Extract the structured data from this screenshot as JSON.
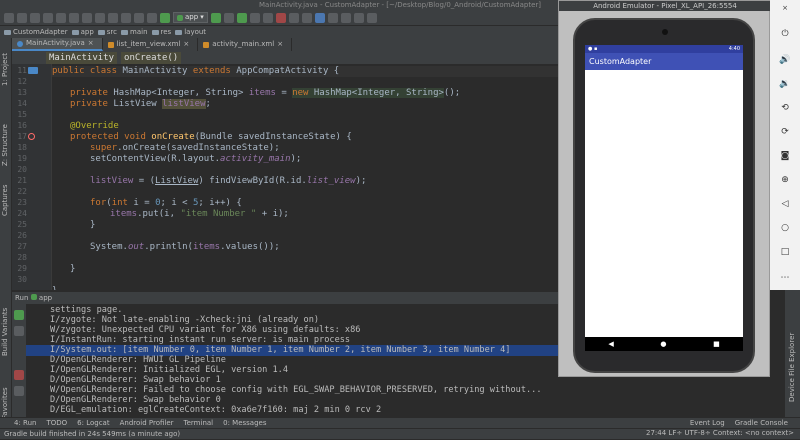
{
  "window_title": "MainActivity.java - CustomAdapter - [~/Desktop/Blog/0_Android/CustomAdapter]",
  "toolbar": {
    "run_config": "app"
  },
  "nav": {
    "items": [
      "CustomAdapter",
      "app",
      "src",
      "main",
      "res",
      "layout"
    ]
  },
  "left_strip": {
    "project": "1: Project",
    "structure": "Z: Structure",
    "captures": "Captures",
    "build_variants": "Build Variants",
    "favorites": "2: Favorites"
  },
  "tabs": [
    {
      "label": "MainActivity.java"
    },
    {
      "label": "list_item_view.xml"
    },
    {
      "label": "activity_main.xml"
    }
  ],
  "breadcrumb": {
    "class": "MainActivity",
    "method": "onCreate()"
  },
  "line_numbers": [
    "11",
    "12",
    "13",
    "14",
    "15",
    "16",
    "17",
    "18",
    "19",
    "20",
    "21",
    "22",
    "23",
    "24",
    "25",
    "26",
    "27",
    "28",
    "29",
    "30",
    "31",
    "32"
  ],
  "code": {
    "l11": {
      "kw": "public class ",
      "cls": "MainActivity ",
      "kw2": "extends ",
      "base": "AppCompatActivity {"
    },
    "l13": {
      "kw": "private ",
      "type": "HashMap<Integer, String> ",
      "field": "items",
      "eq": " = ",
      "kwnew": "new ",
      "ctor": "HashMap<Integer, String>",
      "end": "();"
    },
    "l14": {
      "kw": "private ",
      "type": "ListView ",
      "field": "listView",
      "end": ";"
    },
    "l16": {
      "ann": "@Override"
    },
    "l17": {
      "kw": "protected void ",
      "fn": "onCreate",
      "rest": "(Bundle savedInstanceState) {"
    },
    "l18": {
      "kw": "super",
      "rest": ".onCreate(savedInstanceState);"
    },
    "l19": {
      "pre": "setContentView(R.layout.",
      "it": "activity_main",
      "end": ");"
    },
    "l21": {
      "field": "listView",
      "mid": " = (",
      "cast": "ListView",
      "mid2": ") findViewById(R.id.",
      "it": "list_view",
      "end": ");"
    },
    "l23": {
      "kw": "for",
      "a": "(",
      "kw2": "int ",
      "b": "i = ",
      "n0": "0",
      "c": "; i < ",
      "n5": "5",
      "d": "; i++) {"
    },
    "l24": {
      "field": "items",
      "a": ".put(i, ",
      "str": "\"item Number \"",
      "b": " + i);"
    },
    "l25": {
      "text": "}"
    },
    "l27": {
      "pre": "System.",
      "it": "out",
      "mid": ".println(",
      "field": "items",
      "end": ".values());"
    },
    "l29": {
      "text": "}"
    },
    "l31": {
      "text": "}"
    }
  },
  "run_header": {
    "label": "Run",
    "config": "app"
  },
  "console_lines": [
    "settings page.",
    "I/zygote: Not late-enabling -Xcheck:jni (already on)",
    "W/zygote: Unexpected CPU variant for X86 using defaults: x86",
    "I/InstantRun: starting instant run server: is main process",
    "I/System.out: [item Number 0, item Number 1, item Number 2, item Number 3, item Number 4]",
    "D/OpenGLRenderer: HWUI GL Pipeline",
    "I/OpenGLRenderer: Initialized EGL, version 1.4",
    "D/OpenGLRenderer: Swap behavior 1",
    "W/OpenGLRenderer: Failed to choose config with EGL_SWAP_BEHAVIOR_PRESERVED, retrying without...",
    "D/OpenGLRenderer: Swap behavior 0",
    "D/EGL_emulation: eglCreateContext: 0xa6e7f160: maj 2 min 0 rcv 2"
  ],
  "bottom_tabs": [
    "4: Run",
    "TODO",
    "6: Logcat",
    "Android Profiler",
    "Terminal",
    "0: Messages",
    "Event Log",
    "Gradle Console"
  ],
  "status": {
    "message": "Gradle build finished in 24s 549ms (a minute ago)",
    "right": "27:44   LF÷   UTF-8÷   Context: <no context>"
  },
  "right_strip": {
    "device_explorer": "Device File Explorer"
  },
  "emulator": {
    "title": "Android Emulator - Pixel_XL_API_26:5554",
    "status_time": "4:40",
    "app_title": "CustomAdapter"
  },
  "colors": {
    "ide_bg": "#2b2b2b",
    "app_bar": "#3f51b5",
    "selection": "#214283"
  }
}
